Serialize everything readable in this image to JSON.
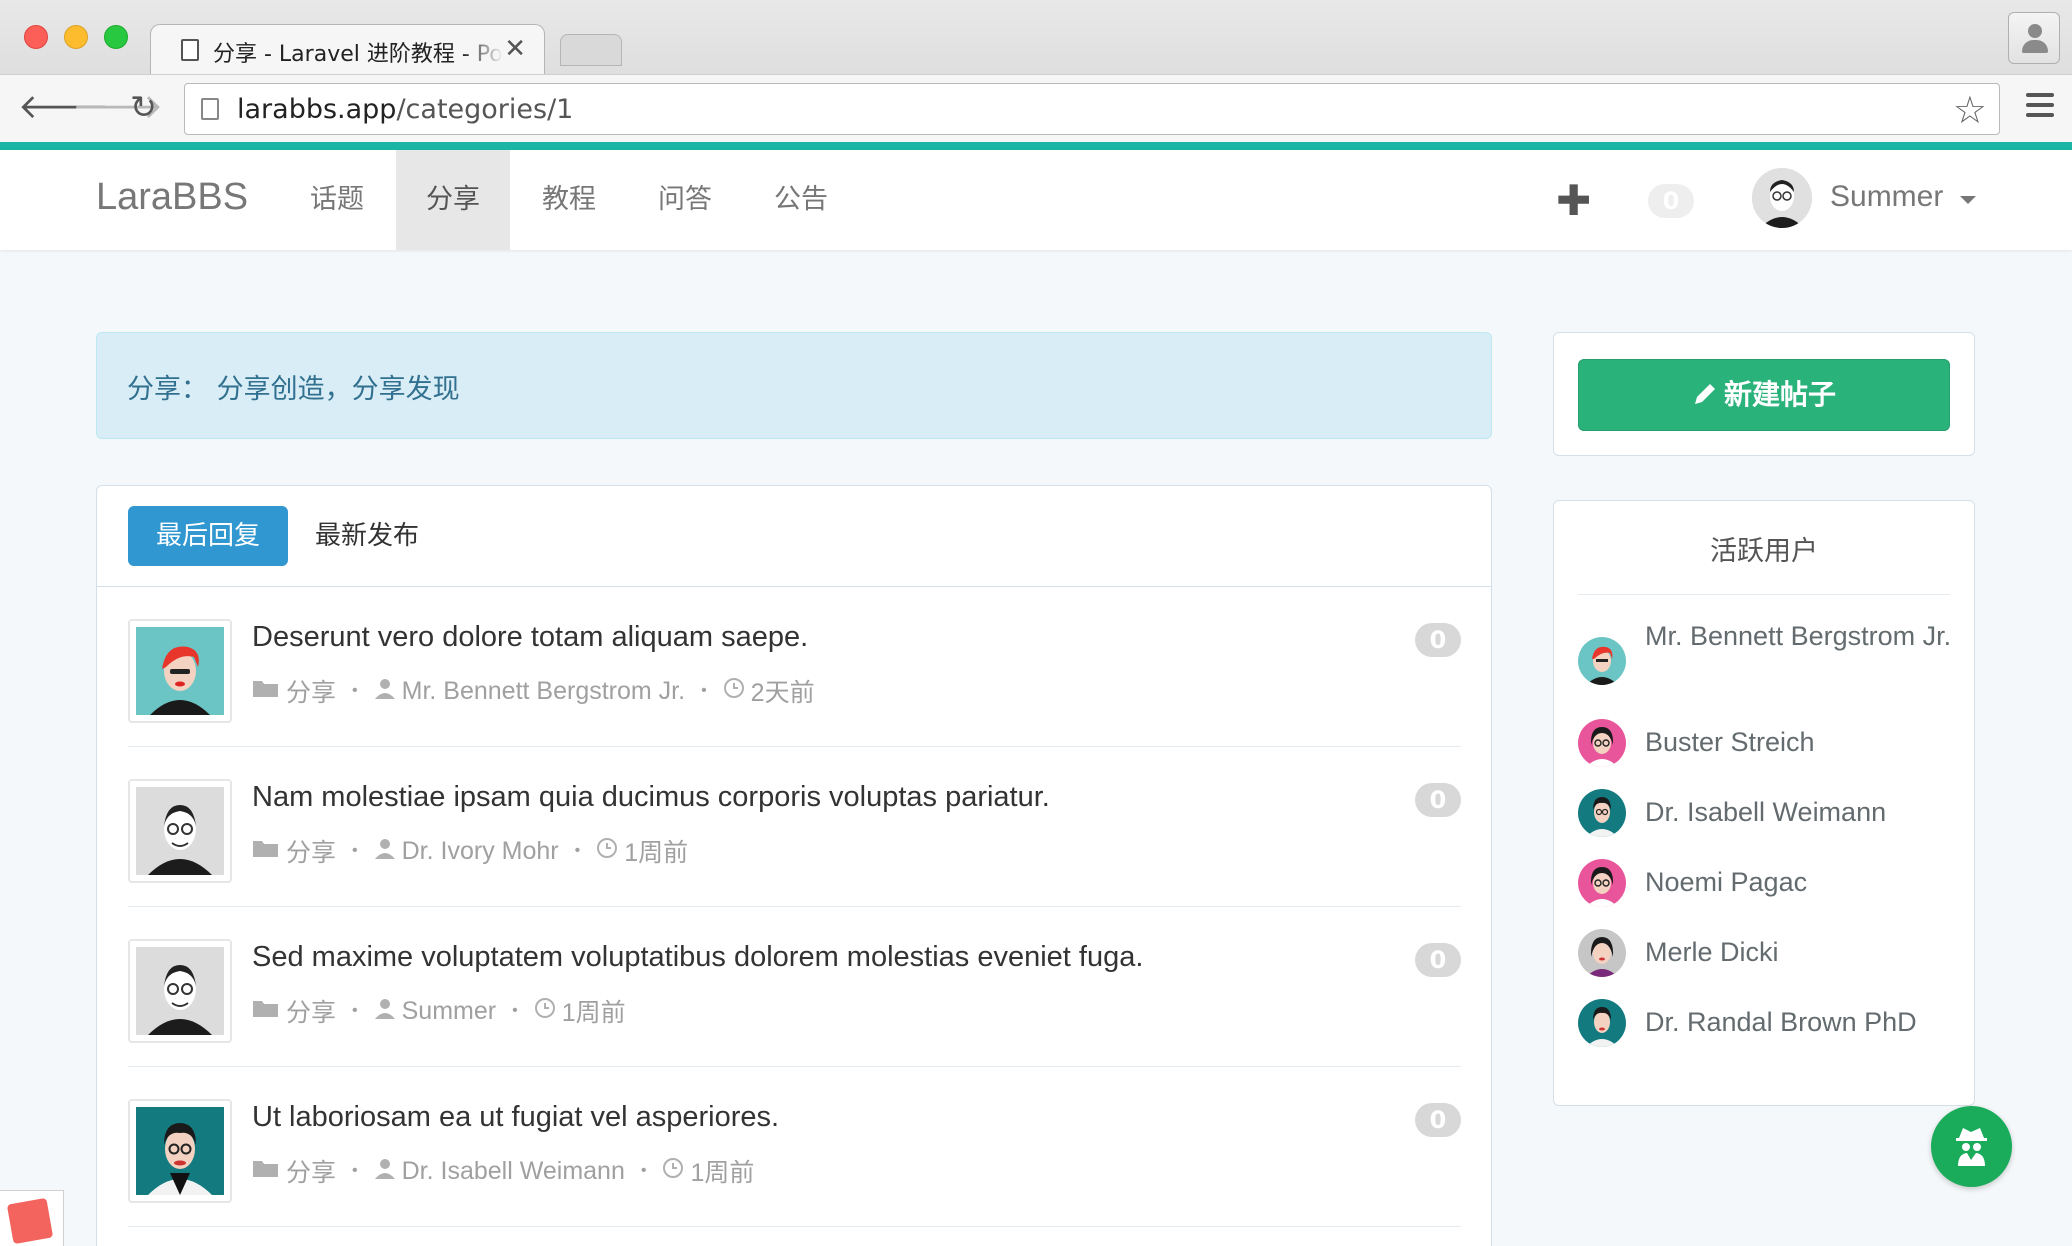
{
  "browser": {
    "tab_title": "分享 - Laravel 进阶教程 - Po",
    "url_host": "larabbs.app",
    "url_path": "/categories/1"
  },
  "navbar": {
    "brand": "LaraBBS",
    "items": [
      {
        "label": "话题"
      },
      {
        "label": "分享"
      },
      {
        "label": "教程"
      },
      {
        "label": "问答"
      },
      {
        "label": "公告"
      }
    ],
    "active_item": "分享",
    "plus": "✚",
    "notification_count": "0",
    "user_name": "Summer"
  },
  "alert": {
    "text": "分享： 分享创造，分享发现"
  },
  "topic_tabs": {
    "active": "最后回复",
    "other": "最新发布"
  },
  "topics": [
    {
      "title": "Deserunt vero dolore totam aliquam saepe.",
      "category": "分享",
      "author": "Mr. Bennett Bergstrom Jr.",
      "time": "2天前",
      "replies": "0",
      "avatar": "red-hair-woman-teal"
    },
    {
      "title": "Nam molestiae ipsam quia ducimus corporis voluptas pariatur.",
      "category": "分享",
      "author": "Dr. Ivory Mohr",
      "time": "1周前",
      "replies": "0",
      "avatar": "bald-man-gray"
    },
    {
      "title": "Sed maxime voluptatem voluptatibus dolorem molestias eveniet fuga.",
      "category": "分享",
      "author": "Summer",
      "time": "1周前",
      "replies": "0",
      "avatar": "bald-man-gray"
    },
    {
      "title": "Ut laboriosam ea ut fugiat vel asperiores.",
      "category": "分享",
      "author": "Dr. Isabell Weimann",
      "time": "1周前",
      "replies": "0",
      "avatar": "dark-hair-man-teal"
    }
  ],
  "sidebar": {
    "new_post_label": "新建帖子",
    "active_users_title": "活跃用户",
    "active_users": [
      {
        "name": "Mr. Bennett Bergstrom Jr.",
        "avatar": "red-hair-woman-teal"
      },
      {
        "name": "Buster Streich",
        "avatar": "woman-pink"
      },
      {
        "name": "Dr. Isabell Weimann",
        "avatar": "man-teal"
      },
      {
        "name": "Noemi Pagac",
        "avatar": "woman-pink"
      },
      {
        "name": "Merle Dicki",
        "avatar": "woman-gray"
      },
      {
        "name": "Dr. Randal Brown PhD",
        "avatar": "man-teal"
      }
    ]
  },
  "colors": {
    "accent_teal": "#1bb5a5",
    "primary_blue": "#3097d1",
    "success_green": "#2ab27b",
    "alert_bg": "#d9edf7",
    "alert_text": "#31708f"
  }
}
